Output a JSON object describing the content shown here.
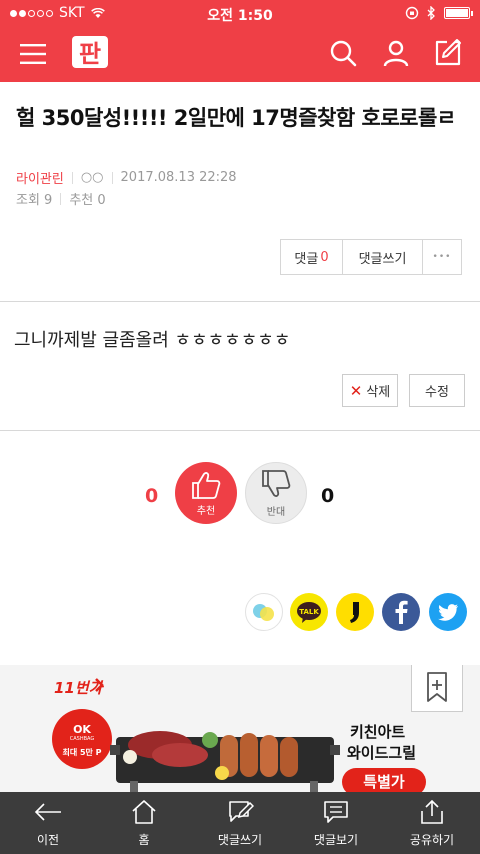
{
  "status_bar": {
    "carrier": "SKT",
    "time": "오전 1:50"
  },
  "header": {
    "logo_text": "판"
  },
  "post": {
    "title": "헐 350달성!!!!! 2일만에 17명즐찾함 호로로롤ㄹ",
    "author": "라이관린",
    "author_id": "○○",
    "datetime": "2017.08.13 22:28",
    "views": "조회 9",
    "recommend": "추천 0",
    "body": "그니까제발 글좀올려 ㅎㅎㅎㅎㅎㅎㅎ"
  },
  "comment_tools": {
    "comments_label": "댓글",
    "comments_count": "0",
    "write_label": "댓글쓰기",
    "more_label": "•••"
  },
  "edit_tools": {
    "delete_label": "삭제",
    "edit_label": "수정"
  },
  "vote": {
    "up_count": "0",
    "up_label": "추천",
    "down_label": "반대",
    "down_count": "0"
  },
  "share": [
    {
      "icon": "kakaostory-icon",
      "color": "#ffffff"
    },
    {
      "icon": "kakaotalk-icon",
      "color": "#f7e600",
      "text": "TALK"
    },
    {
      "icon": "band-icon",
      "color": "#ffde00"
    },
    {
      "icon": "facebook-icon",
      "color": "#3b5998"
    },
    {
      "icon": "twitter-icon",
      "color": "#1da1f2"
    }
  ],
  "ad": {
    "brand": "11번가",
    "ok_top": "OK",
    "ok_mid": "CASHBAG",
    "ok_bottom": "최대 5만 P",
    "product_line1": "키친아트",
    "product_line2": "와이드그릴",
    "promo": "특별가"
  },
  "bottom_nav": [
    {
      "label": "이전",
      "icon": "back-arrow-icon"
    },
    {
      "label": "홈",
      "icon": "home-icon"
    },
    {
      "label": "댓글쓰기",
      "icon": "write-comment-icon"
    },
    {
      "label": "댓글보기",
      "icon": "view-comments-icon"
    },
    {
      "label": "공유하기",
      "icon": "share-icon"
    }
  ],
  "colors": {
    "brand": "#ef3f46",
    "bottom_bar": "#3c3c3c"
  }
}
